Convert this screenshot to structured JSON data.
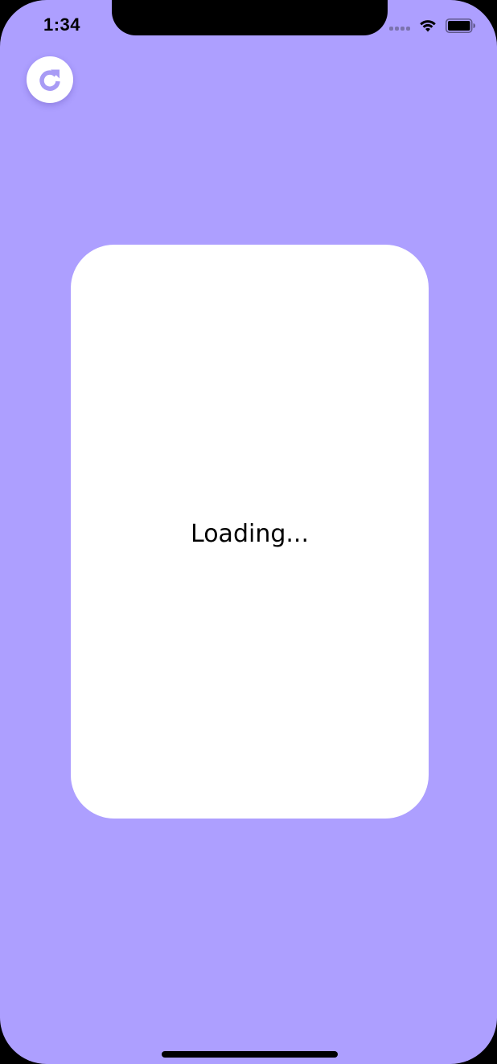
{
  "status_bar": {
    "time": "1:34",
    "icons": [
      "cellular-signal-icon",
      "wifi-icon",
      "battery-icon"
    ]
  },
  "toolbar": {
    "reload_icon": "reload-icon"
  },
  "card": {
    "loading_text": "Loading..."
  },
  "colors": {
    "background": "#ad9fff",
    "accent": "#a89bf5",
    "card": "#ffffff"
  }
}
